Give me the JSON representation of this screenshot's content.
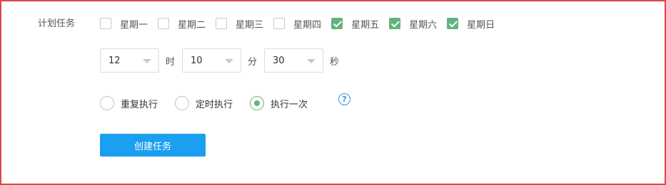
{
  "form": {
    "title": "计划任务",
    "weekdays": [
      {
        "label": "星期一",
        "checked": false
      },
      {
        "label": "星期二",
        "checked": false
      },
      {
        "label": "星期三",
        "checked": false
      },
      {
        "label": "星期四",
        "checked": false
      },
      {
        "label": "星期五",
        "checked": true
      },
      {
        "label": "星期六",
        "checked": true
      },
      {
        "label": "星期日",
        "checked": true
      }
    ],
    "time": {
      "hour": "12",
      "hour_unit": "时",
      "minute": "10",
      "minute_unit": "分",
      "second": "30",
      "second_unit": "秒"
    },
    "modes": [
      {
        "label": "重复执行",
        "checked": false
      },
      {
        "label": "定时执行",
        "checked": false
      },
      {
        "label": "执行一次",
        "checked": true
      }
    ],
    "help_icon": "question-circle-icon",
    "help_glyph": "?",
    "create_button": "创建任务"
  },
  "colors": {
    "accent_green": "#62b37d",
    "button_blue": "#1a9ff1",
    "frame_red": "#e0454a"
  }
}
